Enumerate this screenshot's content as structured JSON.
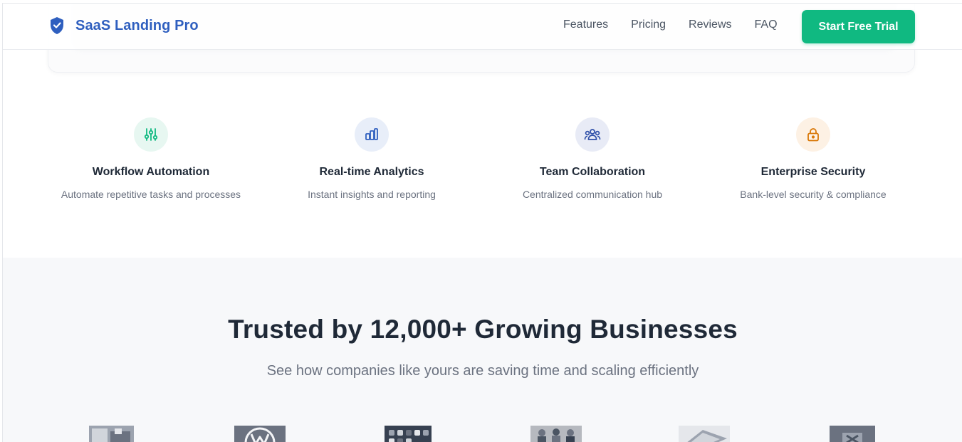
{
  "header": {
    "brand": "SaaS Landing Pro",
    "nav": [
      "Features",
      "Pricing",
      "Reviews",
      "FAQ"
    ],
    "cta_label": "Start Free Trial",
    "brand_color": "#2f5fbf",
    "cta_color": "#10b981"
  },
  "features": [
    {
      "icon": "sliders-icon",
      "title": "Workflow Automation",
      "desc": "Automate repetitive tasks and processes",
      "color": "#10b981"
    },
    {
      "icon": "analytics-icon",
      "title": "Real-time Analytics",
      "desc": "Instant insights and reporting",
      "color": "#2f5fbf"
    },
    {
      "icon": "team-icon",
      "title": "Team Collaboration",
      "desc": "Centralized communication hub",
      "color": "#2f5fbf"
    },
    {
      "icon": "lock-icon",
      "title": "Enterprise Security",
      "desc": "Bank-level security & compliance",
      "color": "#d97706"
    }
  ],
  "trust": {
    "title": "Trusted by 12,000+ Growing Businesses",
    "subtitle": "See how companies like yours are saving time and scaling efficiently",
    "logos": [
      "office-photo",
      "volkswagen-logo",
      "app-icons-photo",
      "team-photo",
      "laptop-photo",
      "product-photo"
    ]
  }
}
